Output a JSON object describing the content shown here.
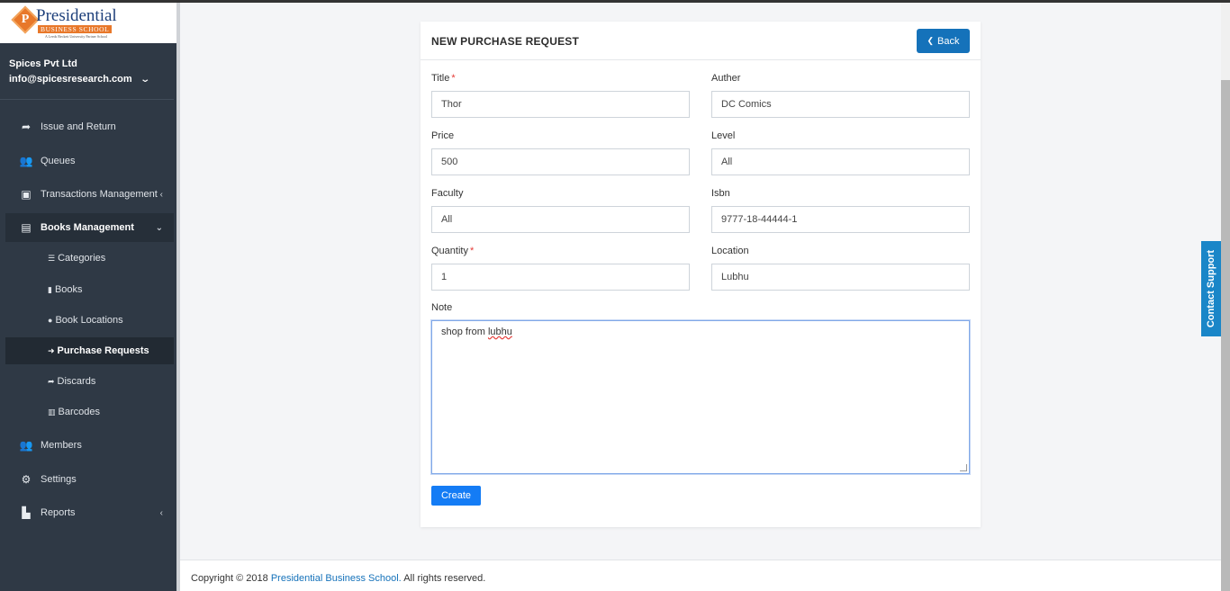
{
  "logo": {
    "title": "Presidential",
    "subtitle": "BUSINESS SCHOOL",
    "tagline": "A Leeds Beckett University Partner School",
    "letter": "P"
  },
  "user": {
    "company": "Spices Pvt Ltd",
    "email": "info@spicesresearch.com"
  },
  "nav": {
    "issue_return": "Issue and Return",
    "queues": "Queues",
    "transactions": "Transactions Management",
    "books_mgmt": "Books Management",
    "categories": "Categories",
    "books": "Books",
    "book_locations": "Book Locations",
    "purchase_requests": "Purchase Requests",
    "discards": "Discards",
    "barcodes": "Barcodes",
    "members": "Members",
    "settings": "Settings",
    "reports": "Reports"
  },
  "form": {
    "heading": "NEW PURCHASE REQUEST",
    "back_label": "Back",
    "title_label": "Title",
    "title_value": "Thor",
    "author_label": "Auther",
    "author_value": "DC Comics",
    "price_label": "Price",
    "price_value": "500",
    "level_label": "Level",
    "level_value": "All",
    "faculty_label": "Faculty",
    "faculty_value": "All",
    "isbn_label": "Isbn",
    "isbn_value": "9777-18-44444-1",
    "quantity_label": "Quantity",
    "quantity_value": "1",
    "location_label": "Location",
    "location_value": "Lubhu",
    "note_label": "Note",
    "note_value_prefix": "shop from ",
    "note_value_word": "lubhu",
    "required_mark": "*",
    "create_label": "Create"
  },
  "footer": {
    "prefix": "Copyright © 2018 ",
    "brand": "Presidential Business School.",
    "suffix": " All rights reserved."
  },
  "contact_support": "Contact Support",
  "colors": {
    "sidebar": "#2f3945",
    "primary": "#1572ba",
    "create": "#147cf5",
    "required": "#e53935"
  }
}
